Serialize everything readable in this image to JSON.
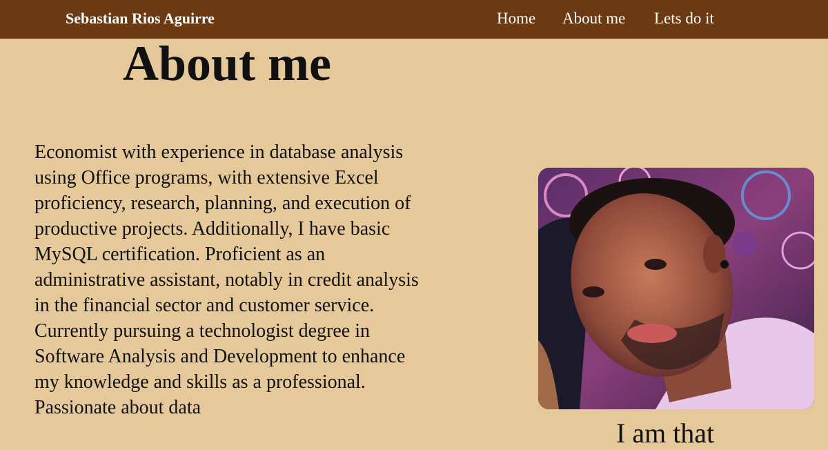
{
  "navbar": {
    "brand": "Sebastian Rios Aguirre",
    "links": [
      "Home",
      "About me",
      "Lets do it"
    ]
  },
  "main": {
    "title": "About me",
    "bio": "Economist with experience in database analysis using Office programs, with extensive Excel proficiency, research, planning, and execution of productive projects. Additionally, I have basic MySQL certification. Proficient as an administrative assistant, notably in credit analysis in the financial sector and customer service. Currently pursuing a technologist degree in Software Analysis and Development to enhance my knowledge and skills as a professional. Passionate about data",
    "photo_caption": "I am that"
  },
  "colors": {
    "navbar": "#6b3a12",
    "background": "#e6c99a",
    "nav_text": "#ffffff"
  }
}
